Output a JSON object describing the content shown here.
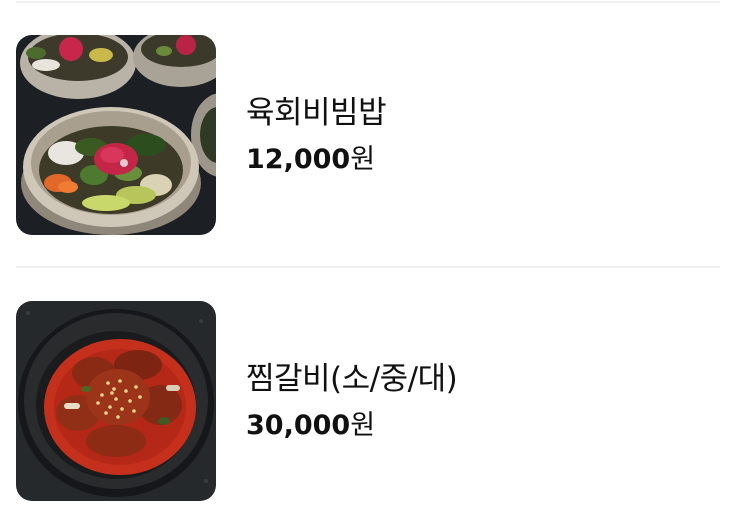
{
  "menu": {
    "items": [
      {
        "name": "육회비빔밥",
        "price": "12,000",
        "currency": "원",
        "image_icon": "yukhoe-bibimbap-photo"
      },
      {
        "name": "찜갈비(소/중/대)",
        "price": "30,000",
        "currency": "원",
        "image_icon": "jjim-galbi-photo"
      }
    ]
  },
  "colors": {
    "text": "#111111",
    "divider": "#eeeeee",
    "background": "#ffffff"
  }
}
